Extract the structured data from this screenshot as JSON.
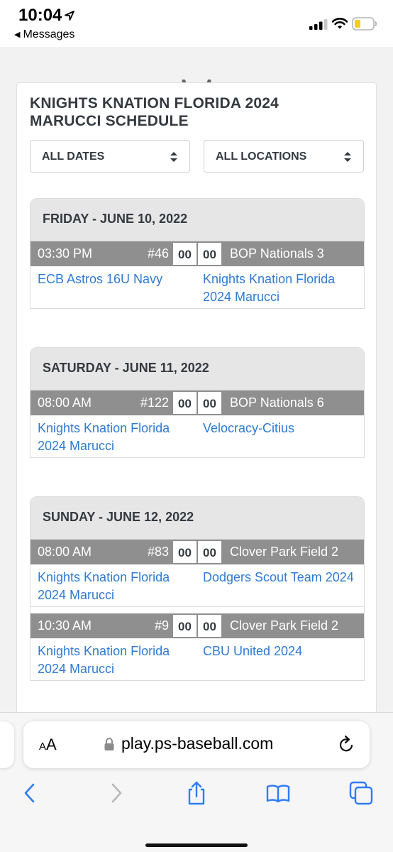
{
  "status_bar": {
    "time": "10:04",
    "back_app": "Messages",
    "icons": [
      "location-arrow-icon",
      "signal-icon",
      "wifi-icon",
      "battery-icon"
    ]
  },
  "schedule": {
    "title": "KNIGHTS KNATION FLORIDA 2024 MARUCCI SCHEDULE",
    "filters": {
      "dates": "ALL DATES",
      "locations": "ALL LOCATIONS"
    },
    "days": [
      {
        "label": "FRIDAY - JUNE 10, 2022",
        "games": [
          {
            "time": "03:30 PM",
            "number": "#46",
            "score_a": "00",
            "score_b": "00",
            "location": "BOP Nationals 3",
            "team_a": "ECB Astros 16U Navy",
            "team_b": "Knights Knation Florida 2024 Marucci"
          }
        ]
      },
      {
        "label": "SATURDAY - JUNE 11, 2022",
        "games": [
          {
            "time": "08:00 AM",
            "number": "#122",
            "score_a": "00",
            "score_b": "00",
            "location": "BOP Nationals 6",
            "team_a": "Knights Knation Florida 2024 Marucci",
            "team_b": "Velocracy-Citius"
          }
        ]
      },
      {
        "label": "SUNDAY - JUNE 12, 2022",
        "games": [
          {
            "time": "08:00 AM",
            "number": "#83",
            "score_a": "00",
            "score_b": "00",
            "location": "Clover Park Field 2",
            "team_a": "Knights Knation Florida 2024 Marucci",
            "team_b": "Dodgers Scout Team 2024"
          },
          {
            "time": "10:30 AM",
            "number": "#9",
            "score_a": "00",
            "score_b": "00",
            "location": "Clover Park Field 2",
            "team_a": "Knights Knation Florida 2024 Marucci",
            "team_b": "CBU United 2024"
          }
        ]
      }
    ]
  },
  "browser": {
    "text_size_label": "AA",
    "url": "play.ps-baseball.com",
    "toolbar": [
      "back-icon",
      "forward-icon",
      "share-icon",
      "bookmarks-icon",
      "tabs-icon"
    ]
  },
  "colors": {
    "link": "#2f7bd4",
    "game_bar": "#8f8f8f",
    "day_header": "#e6e6e6",
    "ios_blue": "#2f7bf6",
    "battery_low": "#f5d10d"
  }
}
